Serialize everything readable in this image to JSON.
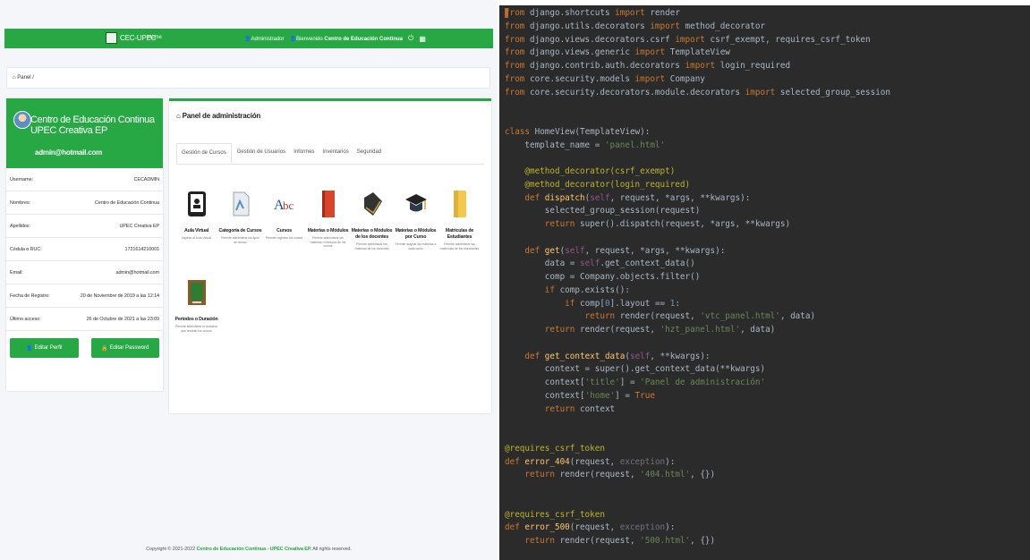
{
  "webapp": {
    "navbar": {
      "brand": "CEC-UPEC",
      "home": "Home",
      "user_role": "Administrador",
      "welcome_prefix": "Bienvenido",
      "welcome_name": "Centro de Educación Continua"
    },
    "breadcrumb": "Panel /",
    "profile": {
      "name": "Centro de Educación Continua UPEC Creativa EP",
      "email": "admin@hotmail.com",
      "fields": [
        {
          "label": "Username:",
          "value": "CECADMIN"
        },
        {
          "label": "Nombres:",
          "value": "Centro de Educación Continua"
        },
        {
          "label": "Apellidos:",
          "value": "UPEC Creativa EP"
        },
        {
          "label": "Cédula o RUC:",
          "value": "1721614210001"
        },
        {
          "label": "Email:",
          "value": "admin@hotmail.com"
        },
        {
          "label": "Fecha de Registro:",
          "value": "20 de Noviembre de 2019 a las 12:14"
        },
        {
          "label": "Último acceso:",
          "value": "26 de Octubre de 2021 a las 23:09"
        }
      ],
      "buttons": {
        "edit_profile": "Editar Perfil",
        "edit_password": "Editar Password"
      }
    },
    "admin_panel": {
      "title": "Panel de administración",
      "tabs": [
        "Gestión de Cursos",
        "Gestión de Usuarios",
        "Informes",
        "Inventarios",
        "Seguridad"
      ],
      "modules": [
        {
          "title": "Aula Virtual",
          "desc": "Ingrese al Aula Virtual",
          "icon": "tablet-icon"
        },
        {
          "title": "Categoría de Cursos",
          "desc": "Permite administrar los tipos de cursos",
          "icon": "document-icon"
        },
        {
          "title": "Cursos",
          "desc": "Permite registrar los cursos",
          "icon": "abc-icon"
        },
        {
          "title": "Materias o Módulos",
          "desc": "Permite administrar las materias o módulos de los cursos",
          "icon": "book-icon"
        },
        {
          "title": "Materias o Módulos de los docentes",
          "desc": "Permite administrar las materias de los docentes",
          "icon": "books-icon"
        },
        {
          "title": "Materias o Módulos por Curso",
          "desc": "Permite asignar las materias a cada curso",
          "icon": "graduation-cap-icon"
        },
        {
          "title": "Matriculas de Estudiantes",
          "desc": "Permite administrar las matriculas de los estudiantes",
          "icon": "folder-icon"
        },
        {
          "title": "Periodos o Duración",
          "desc": "Permite administrar la duración que tendrán los cursos",
          "icon": "chalkboard-icon"
        }
      ]
    },
    "footer": {
      "prefix": "Copyright © 2021-2022",
      "org": "Centro de Educación Continua - UPEC Creativa EP.",
      "suffix": "All rights reserved."
    }
  },
  "editor": {
    "language": "python",
    "lines": [
      "from django.shortcuts import render",
      "from django.utils.decorators import method_decorator",
      "from django.views.decorators.csrf import csrf_exempt, requires_csrf_token",
      "from django.views.generic import TemplateView",
      "from django.contrib.auth.decorators import login_required",
      "from core.security.models import Company",
      "from core.security.decorators.module.decorators import selected_group_session",
      "",
      "",
      "class HomeView(TemplateView):",
      "    template_name = 'panel.html'",
      "",
      "    @method_decorator(csrf_exempt)",
      "    @method_decorator(login_required)",
      "    def dispatch(self, request, *args, **kwargs):",
      "        selected_group_session(request)",
      "        return super().dispatch(request, *args, **kwargs)",
      "",
      "    def get(self, request, *args, **kwargs):",
      "        data = self.get_context_data()",
      "        comp = Company.objects.filter()",
      "        if comp.exists():",
      "            if comp[0].layout == 1:",
      "                return render(request, 'vtc_panel.html', data)",
      "        return render(request, 'hzt_panel.html', data)",
      "",
      "    def get_context_data(self, **kwargs):",
      "        context = super().get_context_data(**kwargs)",
      "        context['title'] = 'Panel de administración'",
      "        context['home'] = True",
      "        return context",
      "",
      "",
      "@requires_csrf_token",
      "def error_404(request, exception):",
      "    return render(request, '404.html', {})",
      "",
      "",
      "@requires_csrf_token",
      "def error_500(request, exception):",
      "    return render(request, '500.html', {})"
    ]
  }
}
